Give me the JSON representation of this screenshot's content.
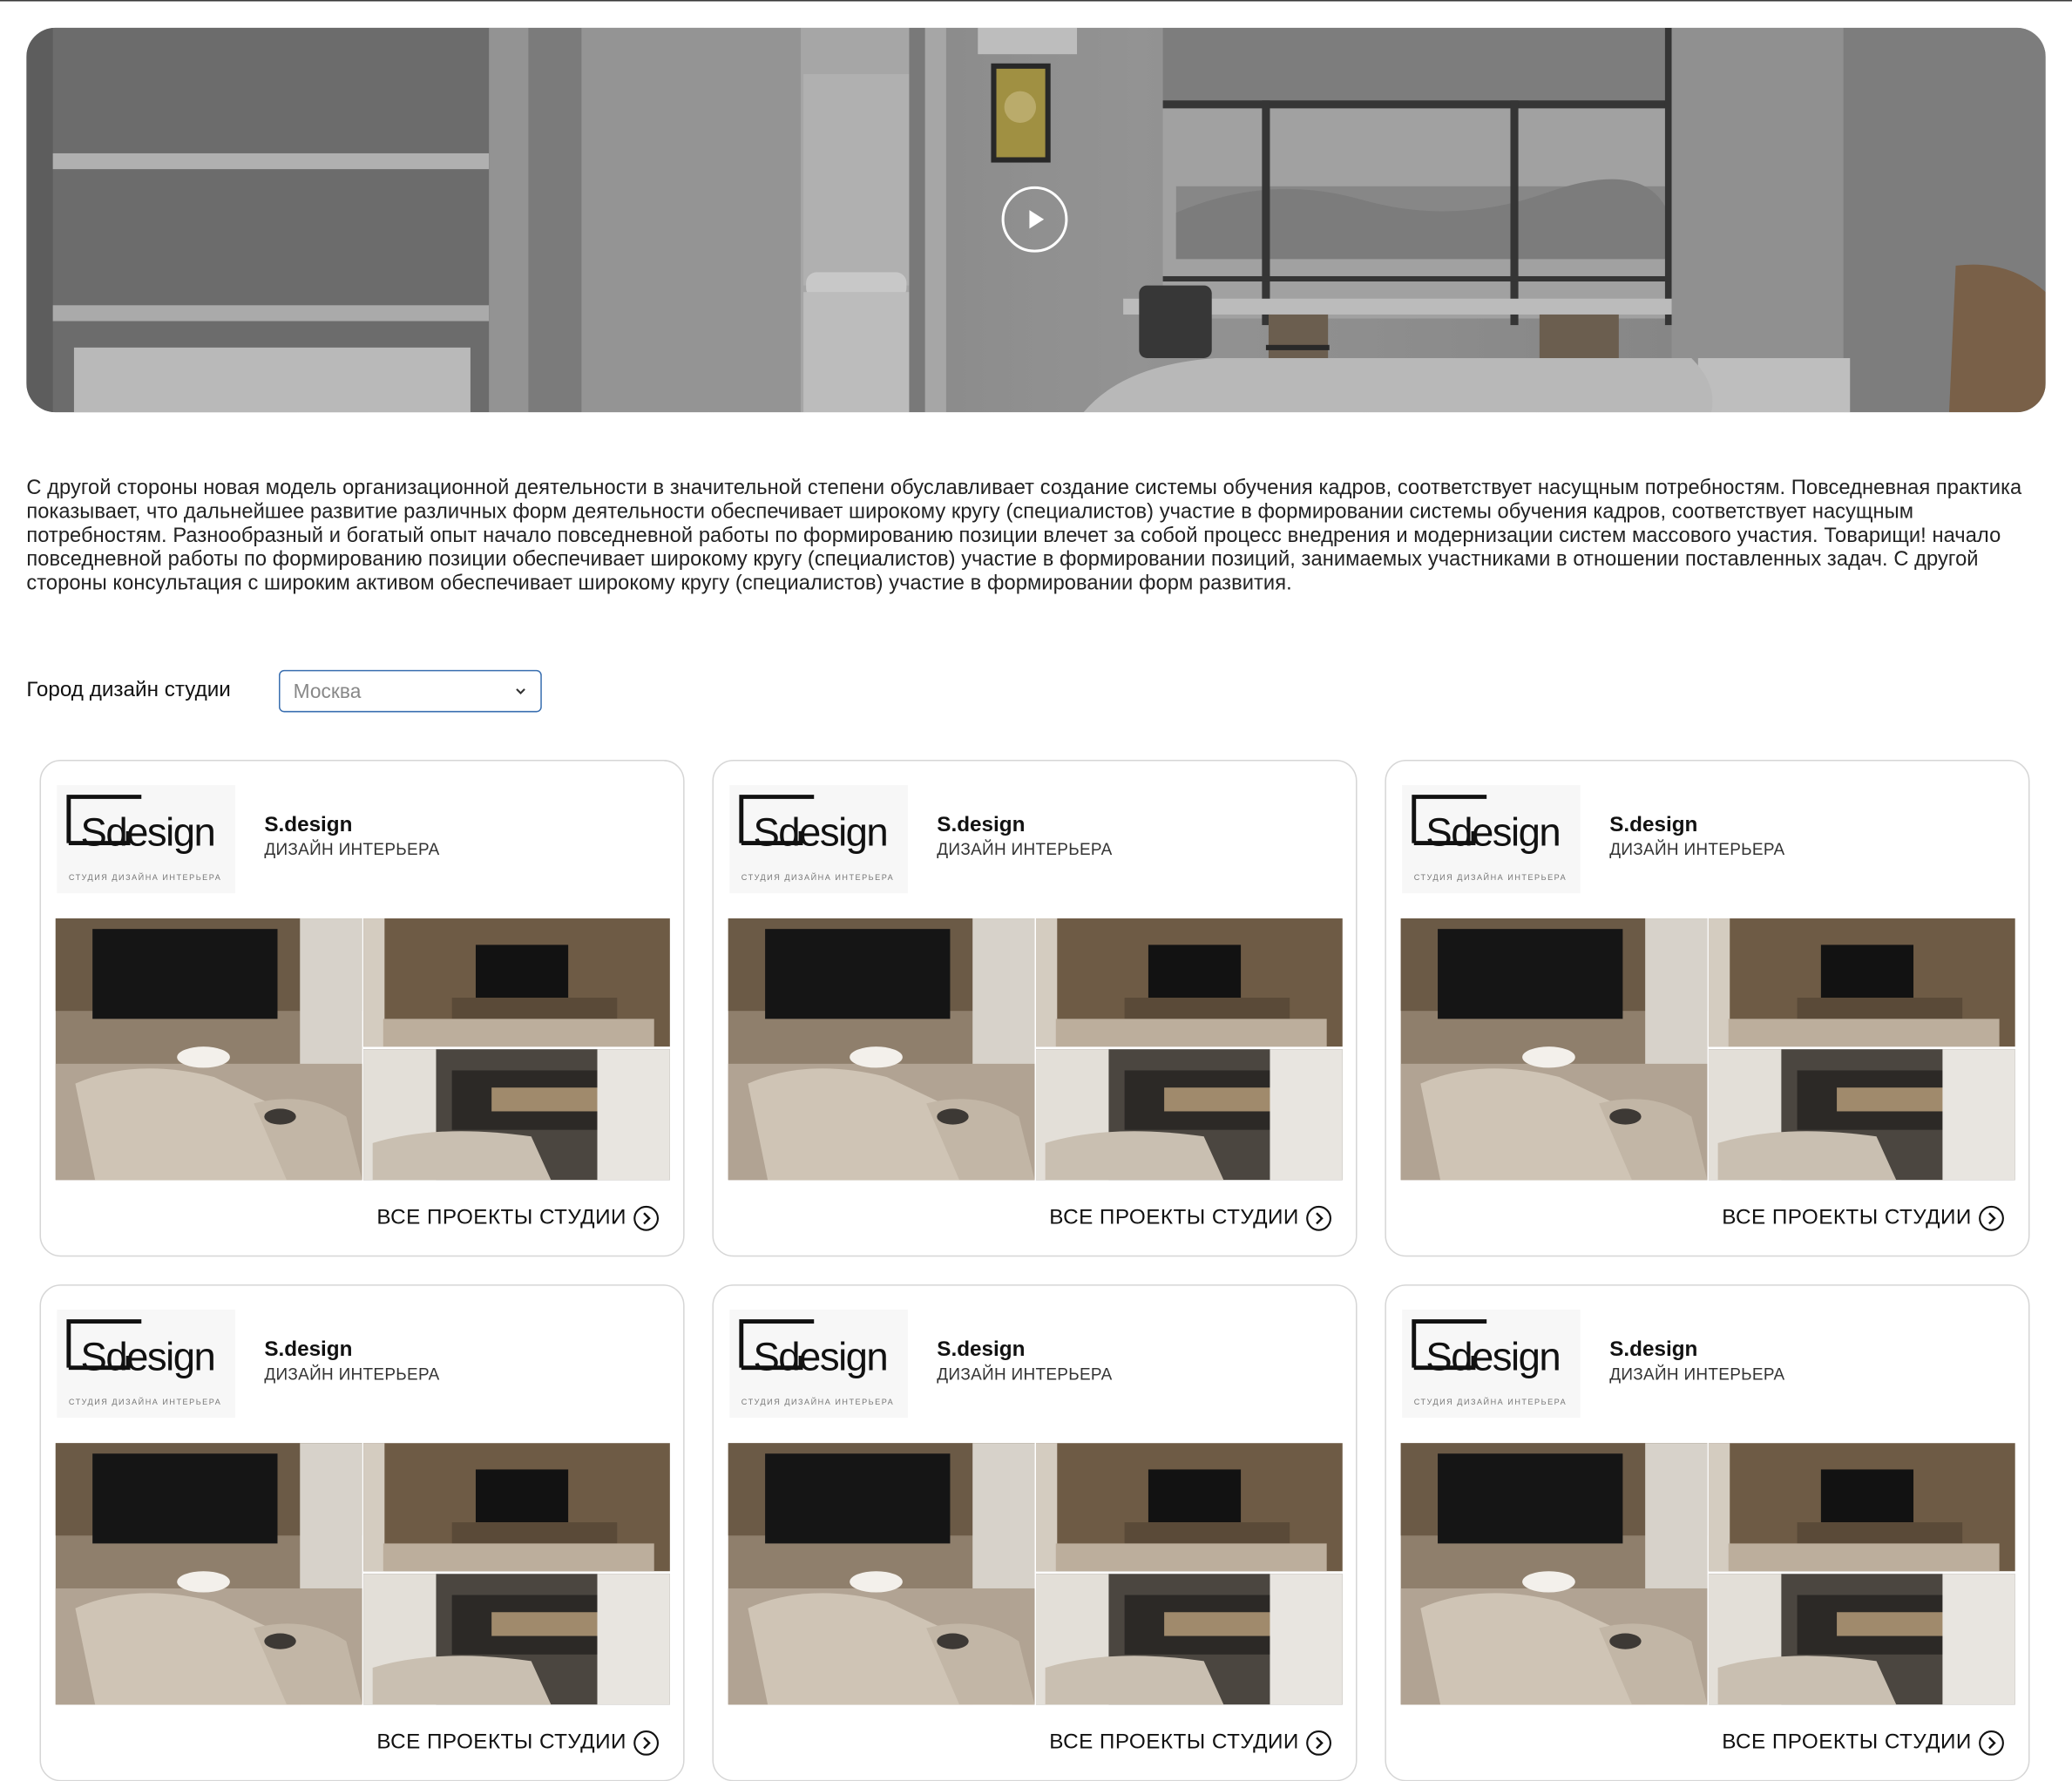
{
  "hero": {
    "play_icon": "play-icon"
  },
  "description": "С другой стороны новая модель организационной деятельности в значительной степени обуславливает создание системы обучения кадров, соответствует насущным потребностям. Повседневная практика показывает, что дальнейшее развитие различных форм деятельности обеспечивает широкому кругу (специалистов) участие в формировании системы обучения кадров, соответствует насущным потребностям. Разнообразный и богатый опыт начало повседневной работы по формированию позиции влечет за собой процесс внедрения и модернизации систем массового участия. Товарищи! начало повседневной работы по формированию позиции обеспечивает широкому кругу (специалистов) участие в формировании позиций, занимаемых участниками в отношении поставленных задач. С другой стороны консультация с широким активом обеспечивает широкому кругу (специалистов) участие в формировании форм развития.",
  "filter": {
    "label": "Город дизайн студии",
    "selected": "Москва"
  },
  "studios": [
    {
      "logo_text": "Sdesign",
      "logo_caption": "СТУДИЯ ДИЗАЙНА ИНТЕРЬЕРА",
      "name": "S.design",
      "type": "ДИЗАЙН ИНТЕРЬЕРА",
      "link_label": "ВСЕ ПРОЕКТЫ СТУДИИ"
    },
    {
      "logo_text": "Sdesign",
      "logo_caption": "СТУДИЯ ДИЗАЙНА ИНТЕРЬЕРА",
      "name": "S.design",
      "type": "ДИЗАЙН ИНТЕРЬЕРА",
      "link_label": "ВСЕ ПРОЕКТЫ СТУДИИ"
    },
    {
      "logo_text": "Sdesign",
      "logo_caption": "СТУДИЯ ДИЗАЙНА ИНТЕРЬЕРА",
      "name": "S.design",
      "type": "ДИЗАЙН ИНТЕРЬЕРА",
      "link_label": "ВСЕ ПРОЕКТЫ СТУДИИ"
    },
    {
      "logo_text": "Sdesign",
      "logo_caption": "СТУДИЯ ДИЗАЙНА ИНТЕРЬЕРА",
      "name": "S.design",
      "type": "ДИЗАЙН ИНТЕРЬЕРА",
      "link_label": "ВСЕ ПРОЕКТЫ СТУДИИ"
    },
    {
      "logo_text": "Sdesign",
      "logo_caption": "СТУДИЯ ДИЗАЙНА ИНТЕРЬЕРА",
      "name": "S.design",
      "type": "ДИЗАЙН ИНТЕРЬЕРА",
      "link_label": "ВСЕ ПРОЕКТЫ СТУДИИ"
    },
    {
      "logo_text": "Sdesign",
      "logo_caption": "СТУДИЯ ДИЗАЙНА ИНТЕРЬЕРА",
      "name": "S.design",
      "type": "ДИЗАЙН ИНТЕРЬЕРА",
      "link_label": "ВСЕ ПРОЕКТЫ СТУДИИ"
    }
  ]
}
